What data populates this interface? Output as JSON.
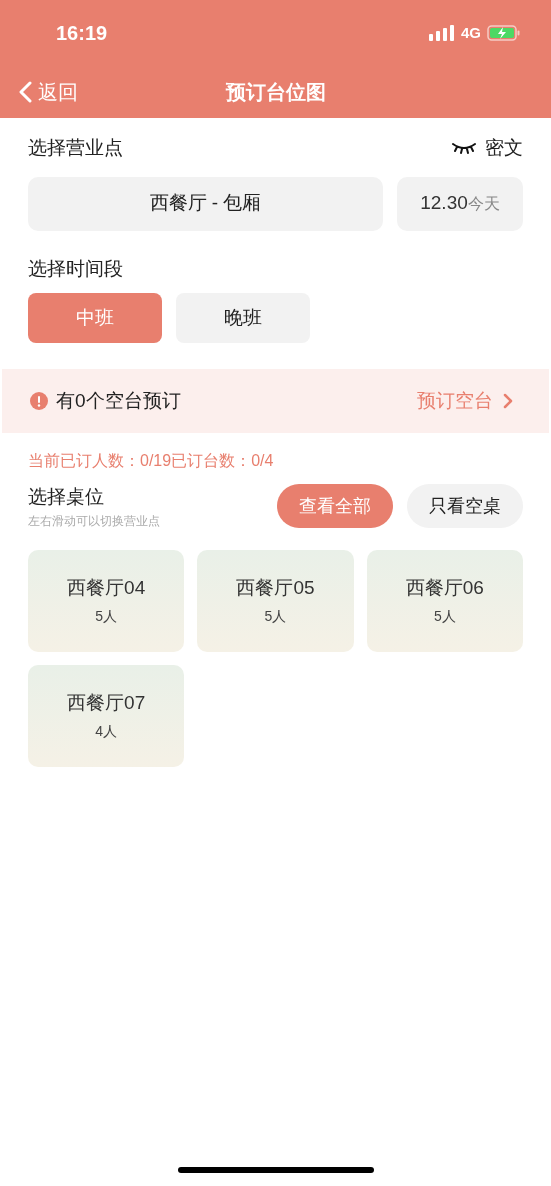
{
  "status_bar": {
    "time": "16:19",
    "network": "4G"
  },
  "nav": {
    "back": "返回",
    "title": "预订台位图"
  },
  "outlet": {
    "label": "选择营业点",
    "mask_toggle": "密文",
    "selected_outlet": "西餐厅 - 包厢",
    "date": "12.30",
    "date_note": "今天"
  },
  "time_slot": {
    "label": "选择时间段",
    "options": [
      {
        "label": "中班",
        "selected": true
      },
      {
        "label": "晚班",
        "selected": false
      }
    ]
  },
  "notice": {
    "text": "有0个空台预订",
    "action": "预订空台"
  },
  "summary": "当前已订人数：0/19已订台数：0/4",
  "tables_section": {
    "title": "选择桌位",
    "hint": "左右滑动可以切换营业点",
    "filters": [
      {
        "label": "查看全部",
        "selected": true
      },
      {
        "label": "只看空桌",
        "selected": false
      }
    ]
  },
  "tables": [
    {
      "name": "西餐厅04",
      "seats": "5人"
    },
    {
      "name": "西餐厅05",
      "seats": "5人"
    },
    {
      "name": "西餐厅06",
      "seats": "5人"
    },
    {
      "name": "西餐厅07",
      "seats": "4人"
    }
  ]
}
